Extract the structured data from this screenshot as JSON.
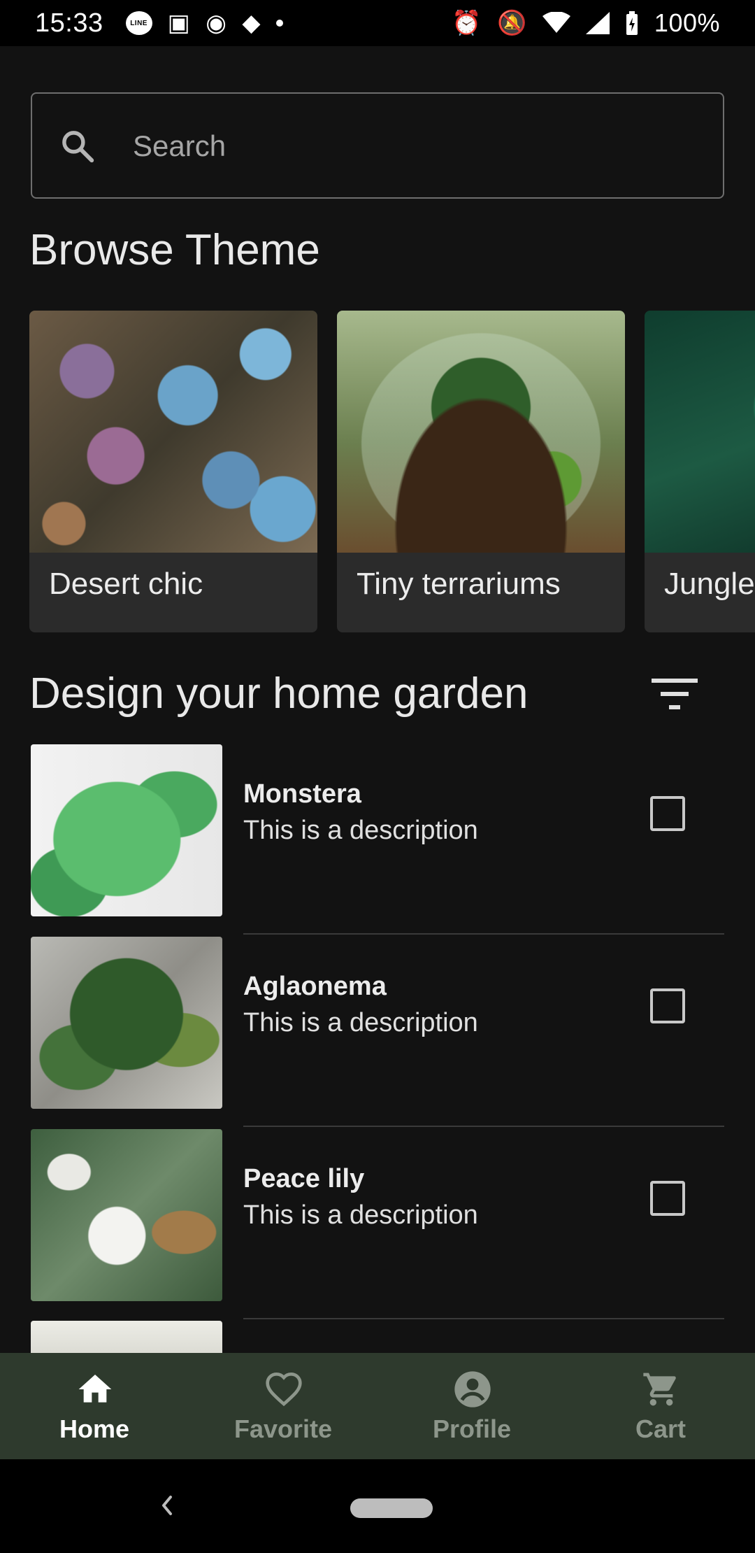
{
  "status_bar": {
    "time": "15:33",
    "battery": "100%",
    "left_icons": [
      "line-icon",
      "news-icon",
      "p-icon",
      "m-icon",
      "dot-icon"
    ],
    "right_icons": [
      "alarm-icon",
      "mute-icon",
      "wifi-icon",
      "signal-icon",
      "battery-charging-icon"
    ]
  },
  "search": {
    "placeholder": "Search",
    "value": ""
  },
  "browse": {
    "title": "Browse Theme",
    "themes": [
      {
        "label": "Desert chic"
      },
      {
        "label": "Tiny terrariums"
      },
      {
        "label": "Jungle"
      }
    ]
  },
  "garden": {
    "title": "Design your home garden",
    "items": [
      {
        "name": "Monstera",
        "description": "This is a description",
        "checked": false
      },
      {
        "name": "Aglaonema",
        "description": "This is a description",
        "checked": false
      },
      {
        "name": "Peace lily",
        "description": "This is a description",
        "checked": false
      }
    ]
  },
  "bottom_nav": {
    "items": [
      {
        "label": "Home",
        "icon": "home-icon",
        "active": true
      },
      {
        "label": "Favorite",
        "icon": "heart-icon",
        "active": false
      },
      {
        "label": "Profile",
        "icon": "account-icon",
        "active": false
      },
      {
        "label": "Cart",
        "icon": "cart-icon",
        "active": false
      }
    ]
  },
  "colors": {
    "background": "#121212",
    "bottom_nav_bg": "#2e3a2d",
    "nav_active": "#ffffff",
    "nav_inactive": "#8d968b"
  }
}
